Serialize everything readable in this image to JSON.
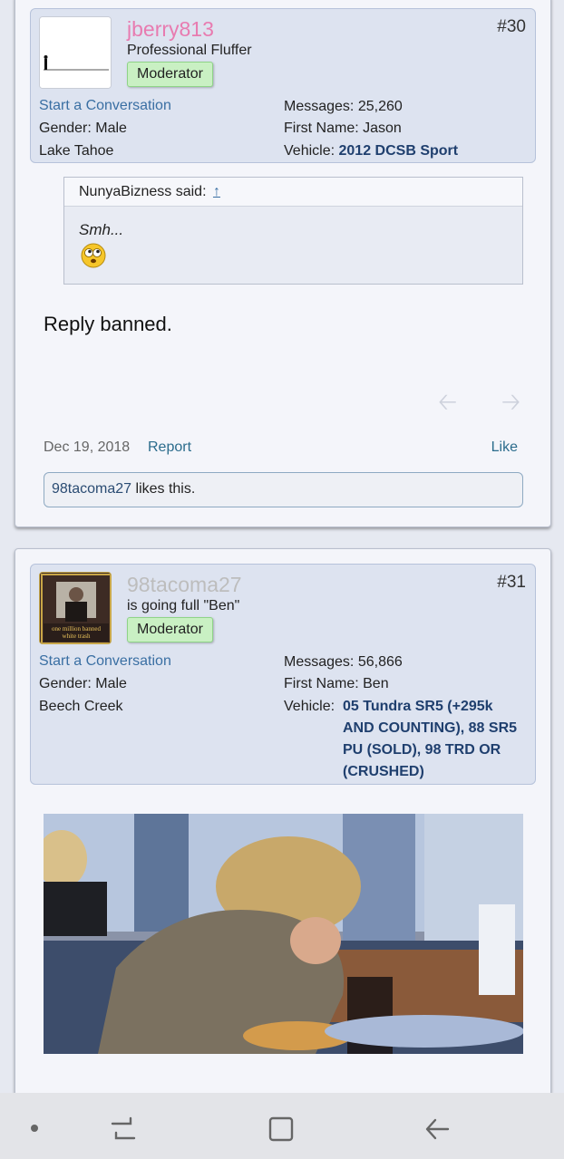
{
  "posts": [
    {
      "number": "#30",
      "user": {
        "name": "jberry813",
        "name_color": "#e87bb0",
        "title": "Professional Fluffer",
        "badge": "Moderator"
      },
      "start_conversation": "Start a Conversation",
      "gender_label": "Gender:",
      "gender": "Male",
      "location": "Lake Tahoe",
      "messages_label": "Messages:",
      "messages": "25,260",
      "first_name_label": "First Name:",
      "first_name": "Jason",
      "vehicle_label": "Vehicle:",
      "vehicle": "2012 DCSB Sport",
      "quote": {
        "author": "NunyaBizness said:",
        "arrow": "↑",
        "text": "Smh..."
      },
      "message": "Reply banned.",
      "date": "Dec 19, 2018",
      "report": "Report",
      "like": "Like",
      "likes_user": "98tacoma27",
      "likes_text": " likes this."
    },
    {
      "number": "#31",
      "user": {
        "name": "98tacoma27",
        "name_color": "#bdbdbd",
        "title": "is going full \"Ben\"",
        "badge": "Moderator",
        "avatar_caption": "one million banned\nwhite trash"
      },
      "start_conversation": "Start a Conversation",
      "gender_label": "Gender:",
      "gender": "Male",
      "location": "Beech Creek",
      "messages_label": "Messages:",
      "messages": "56,866",
      "first_name_label": "First Name:",
      "first_name": "Ben",
      "vehicle_label": "Vehicle:",
      "vehicle": "05 Tundra SR5 (+295k AND COUNTING), 88 SR5 PU (SOLD), 98 TRD OR (CRUSHED)"
    }
  ],
  "icons": {
    "prev": "prev-arrow-icon",
    "next": "next-arrow-icon",
    "nav_dot": "nav-dot-icon",
    "recents": "recents-icon",
    "home": "home-icon",
    "back": "back-icon"
  }
}
